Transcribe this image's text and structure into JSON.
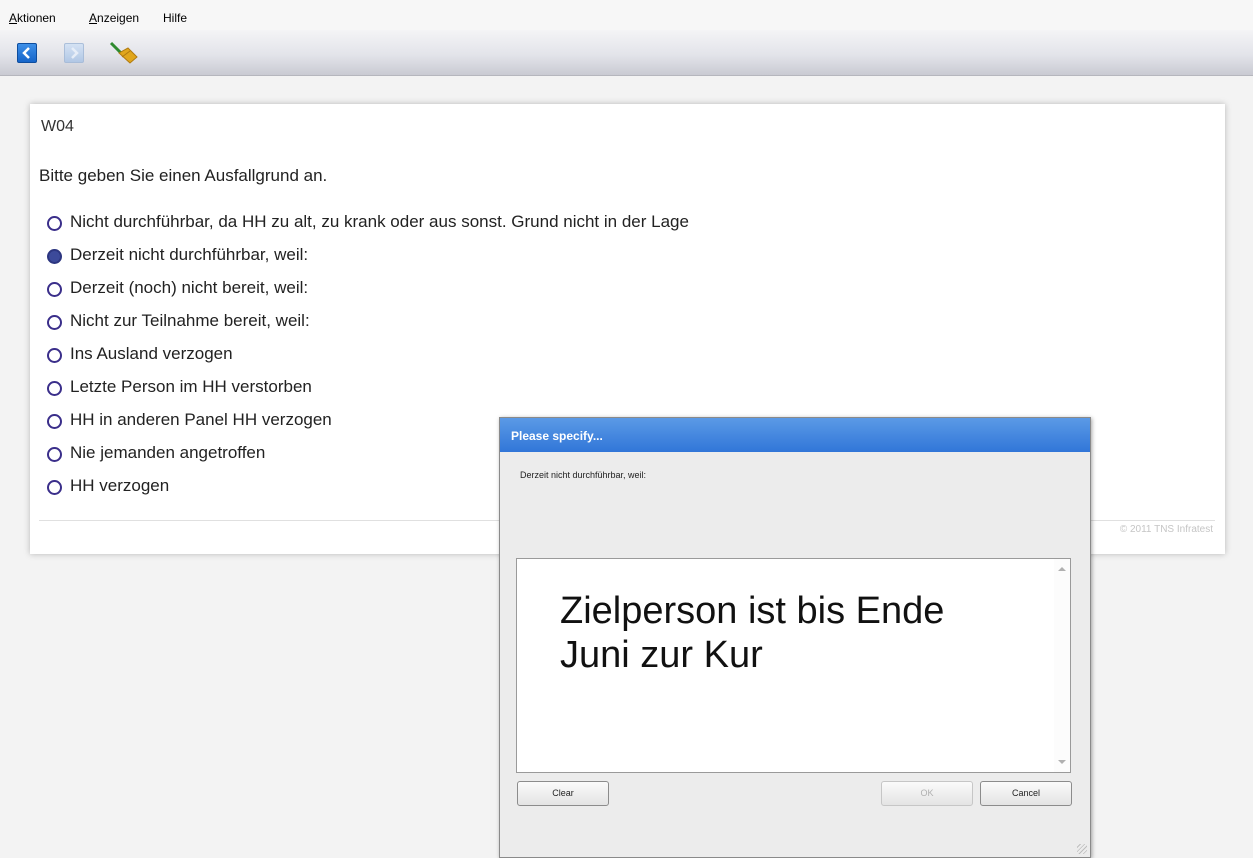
{
  "menu": {
    "items": [
      {
        "accel": "A",
        "rest": "ktionen"
      },
      {
        "accel": "A",
        "rest": "nzeigen"
      },
      {
        "accel": "",
        "rest": "Hilfe"
      }
    ]
  },
  "toolbar": {
    "icons": [
      "back-arrow-icon",
      "forward-arrow-icon",
      "broom-icon"
    ]
  },
  "question": {
    "id": "W04",
    "text": "Bitte geben Sie einen Ausfallgrund an.",
    "options": [
      {
        "label": "Nicht durchführbar, da HH zu alt, zu krank oder aus sonst. Grund nicht in der Lage",
        "selected": false
      },
      {
        "label": "Derzeit nicht durchführbar, weil:",
        "selected": true
      },
      {
        "label": "Derzeit (noch) nicht bereit, weil:",
        "selected": false
      },
      {
        "label": "Nicht zur Teilnahme bereit, weil:",
        "selected": false
      },
      {
        "label": "Ins Ausland verzogen",
        "selected": false
      },
      {
        "label": "Letzte Person im HH verstorben",
        "selected": false
      },
      {
        "label": "HH in anderen Panel HH verzogen",
        "selected": false
      },
      {
        "label": "Nie jemanden angetroffen",
        "selected": false
      },
      {
        "label": "HH verzogen",
        "selected": false
      }
    ],
    "copyright": "© 2011 TNS Infratest"
  },
  "dialog": {
    "title": "Please specify...",
    "prompt": "Derzeit nicht durchführbar, weil:",
    "text_value": "Zielperson ist bis Ende Juni zur Kur",
    "buttons": {
      "clear": "Clear",
      "ok": "OK",
      "cancel": "Cancel"
    }
  },
  "colors": {
    "dialog_title": "#3d86e0",
    "radio_border": "#3a2e8a",
    "radio_selected": "#3c4a9a",
    "back_button": "#1e6fd6"
  }
}
